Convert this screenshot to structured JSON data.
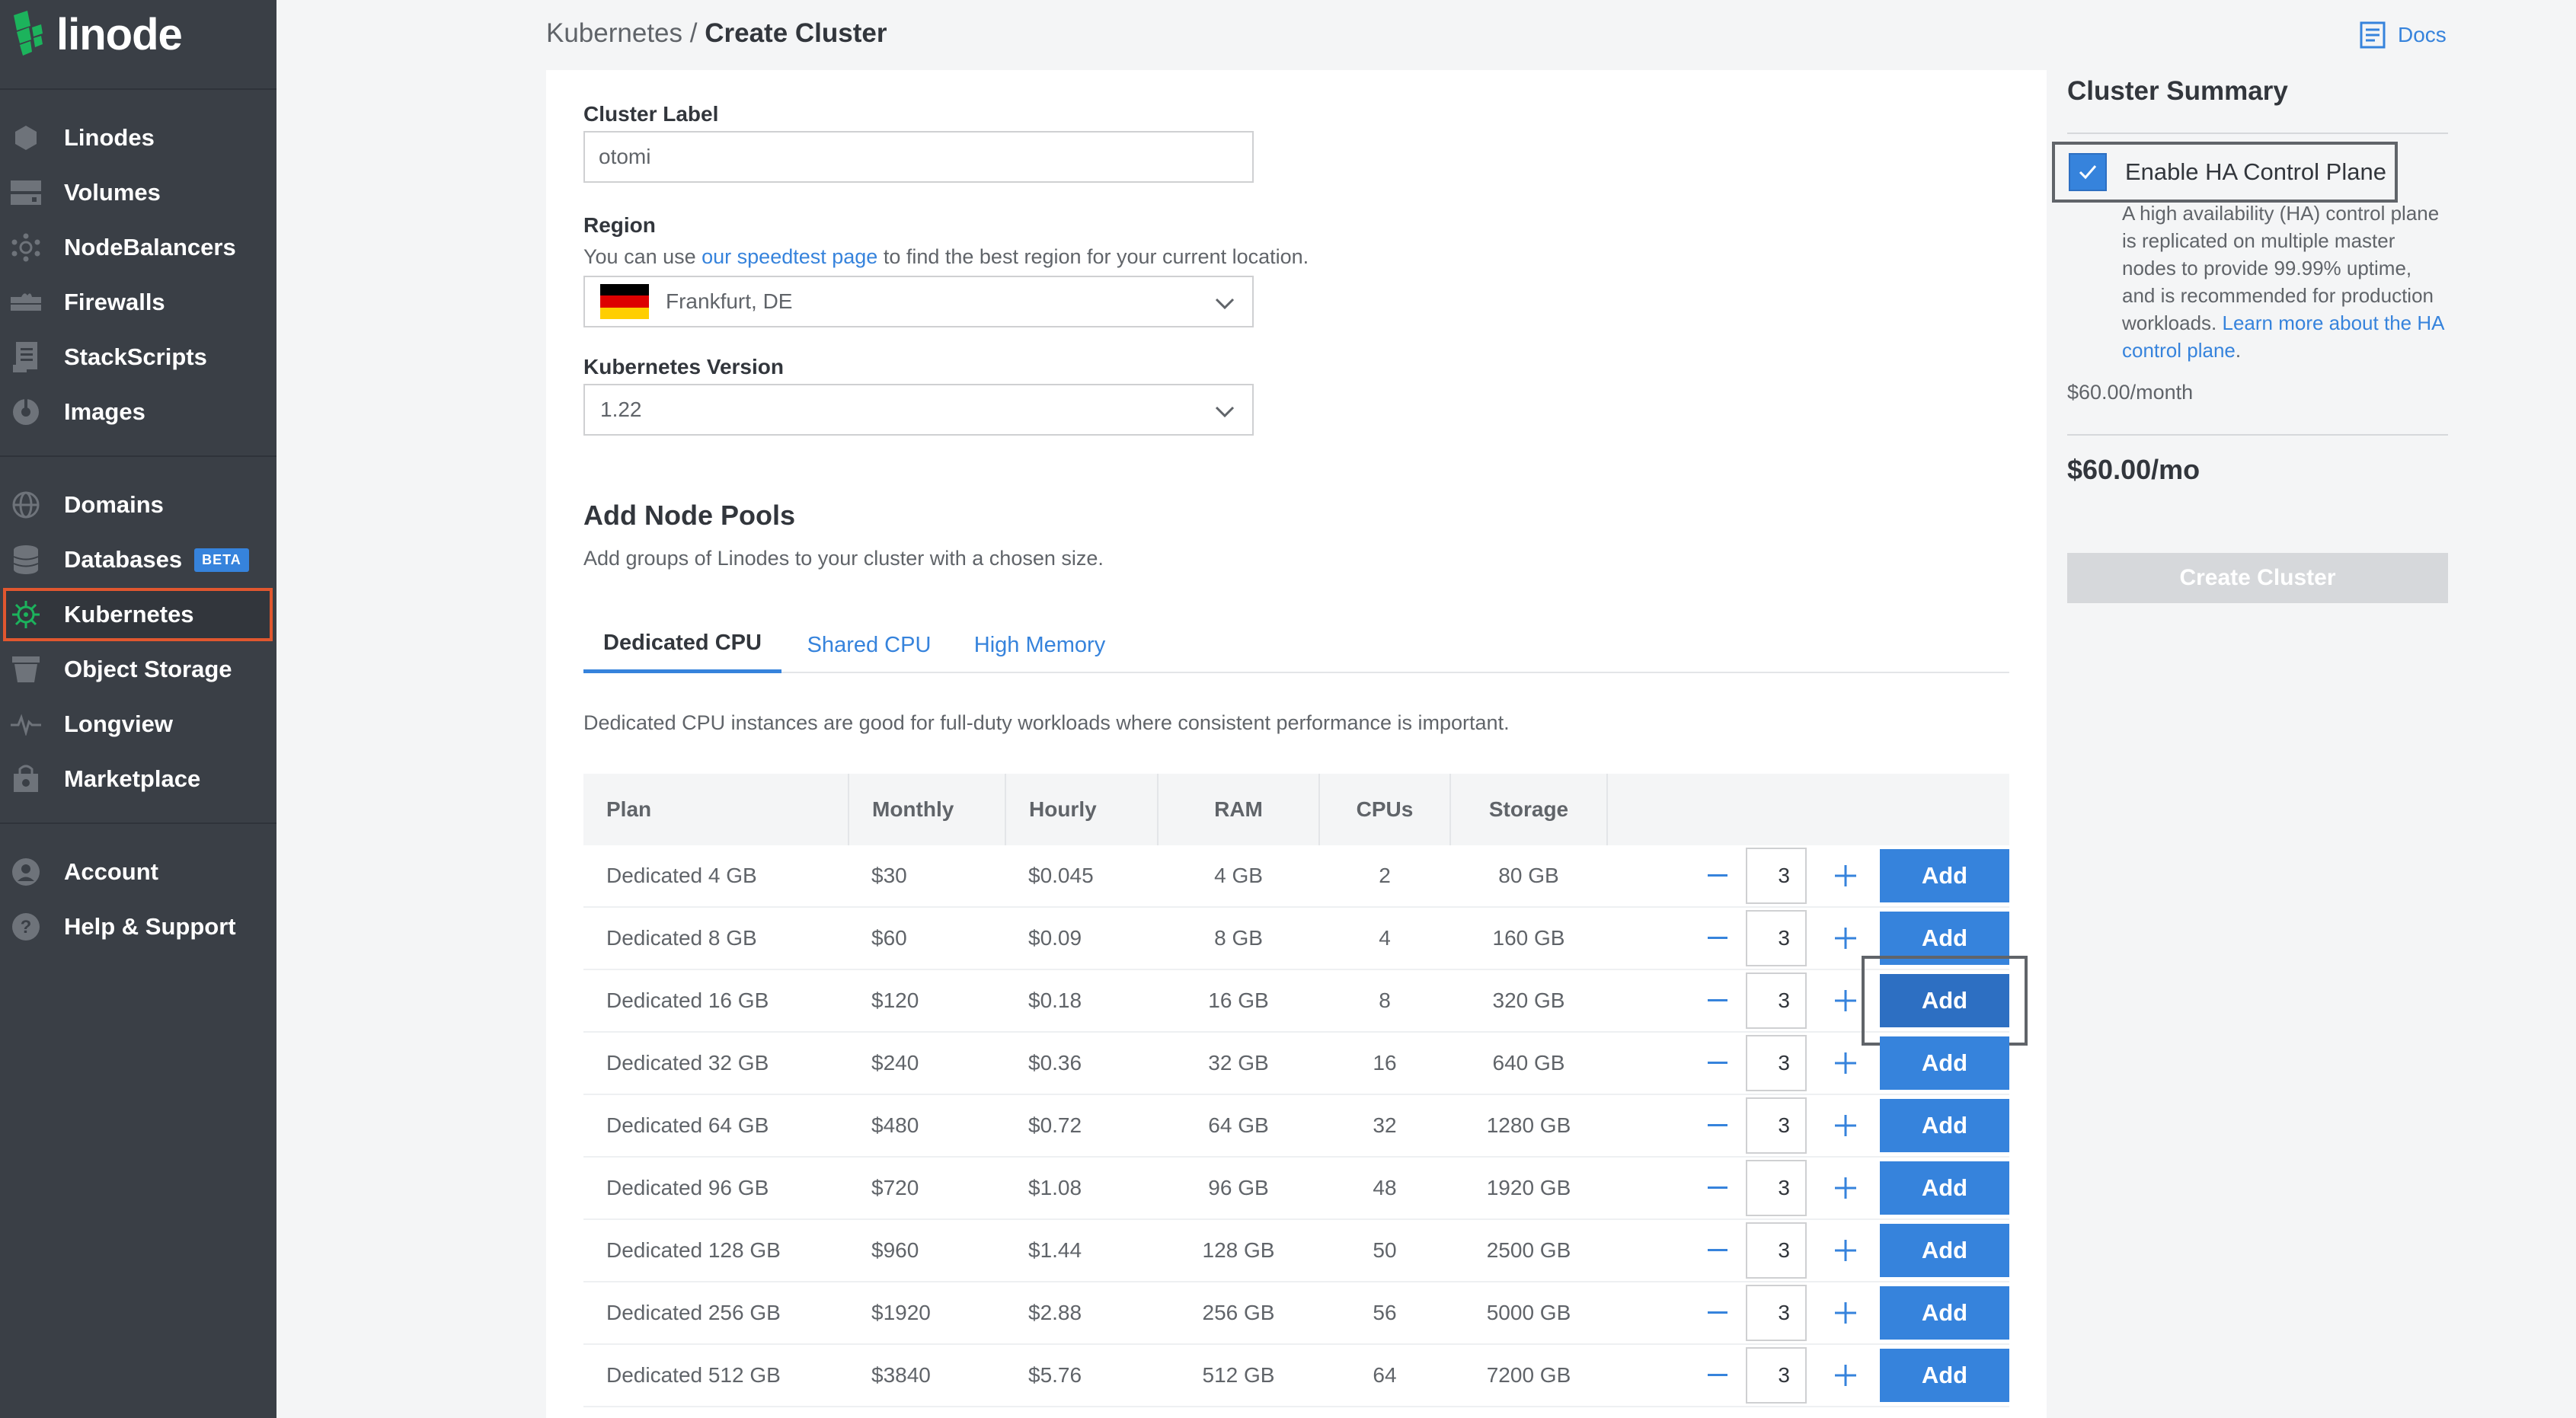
{
  "brand": {
    "name": "linode"
  },
  "nav": {
    "items": [
      {
        "label": "Linodes",
        "icon": "hexagon-icon"
      },
      {
        "label": "Volumes",
        "icon": "drives-icon"
      },
      {
        "label": "NodeBalancers",
        "icon": "network-icon"
      },
      {
        "label": "Firewalls",
        "icon": "firewall-icon"
      },
      {
        "label": "StackScripts",
        "icon": "script-icon"
      },
      {
        "label": "Images",
        "icon": "images-icon"
      },
      {
        "label": "Domains",
        "icon": "globe-icon"
      },
      {
        "label": "Databases",
        "icon": "database-icon",
        "badge": "BETA"
      },
      {
        "label": "Kubernetes",
        "icon": "kubernetes-icon",
        "active": true
      },
      {
        "label": "Object Storage",
        "icon": "bucket-icon"
      },
      {
        "label": "Longview",
        "icon": "pulse-icon"
      },
      {
        "label": "Marketplace",
        "icon": "marketplace-icon"
      },
      {
        "label": "Account",
        "icon": "account-icon"
      },
      {
        "label": "Help & Support",
        "icon": "help-icon"
      }
    ]
  },
  "header": {
    "breadcrumb_parent": "Kubernetes",
    "breadcrumb_sep": "/",
    "breadcrumb_current": "Create Cluster",
    "docs_label": "Docs"
  },
  "form": {
    "cluster_label": {
      "label": "Cluster Label",
      "value": "otomi"
    },
    "region": {
      "label": "Region",
      "helper_prefix": "You can use ",
      "helper_link": "our speedtest page",
      "helper_suffix": " to find the best region for your current location.",
      "value": "Frankfurt, DE"
    },
    "version": {
      "label": "Kubernetes Version",
      "value": "1.22"
    }
  },
  "node_pools": {
    "title": "Add Node Pools",
    "subtitle": "Add groups of Linodes to your cluster with a chosen size.",
    "tabs": [
      "Dedicated CPU",
      "Shared CPU",
      "High Memory"
    ],
    "description": "Dedicated CPU instances are good for full-duty workloads where consistent performance is important.",
    "columns": [
      "Plan",
      "Monthly",
      "Hourly",
      "RAM",
      "CPUs",
      "Storage"
    ],
    "add_label": "Add",
    "rows": [
      {
        "plan": "Dedicated 4 GB",
        "monthly": "$30",
        "hourly": "$0.045",
        "ram": "4 GB",
        "cpus": "2",
        "storage": "80 GB",
        "qty": "3"
      },
      {
        "plan": "Dedicated 8 GB",
        "monthly": "$60",
        "hourly": "$0.09",
        "ram": "8 GB",
        "cpus": "4",
        "storage": "160 GB",
        "qty": "3"
      },
      {
        "plan": "Dedicated 16 GB",
        "monthly": "$120",
        "hourly": "$0.18",
        "ram": "16 GB",
        "cpus": "8",
        "storage": "320 GB",
        "qty": "3",
        "highlight": true
      },
      {
        "plan": "Dedicated 32 GB",
        "monthly": "$240",
        "hourly": "$0.36",
        "ram": "32 GB",
        "cpus": "16",
        "storage": "640 GB",
        "qty": "3"
      },
      {
        "plan": "Dedicated 64 GB",
        "monthly": "$480",
        "hourly": "$0.72",
        "ram": "64 GB",
        "cpus": "32",
        "storage": "1280 GB",
        "qty": "3"
      },
      {
        "plan": "Dedicated 96 GB",
        "monthly": "$720",
        "hourly": "$1.08",
        "ram": "96 GB",
        "cpus": "48",
        "storage": "1920 GB",
        "qty": "3"
      },
      {
        "plan": "Dedicated 128 GB",
        "monthly": "$960",
        "hourly": "$1.44",
        "ram": "128 GB",
        "cpus": "50",
        "storage": "2500 GB",
        "qty": "3"
      },
      {
        "plan": "Dedicated 256 GB",
        "monthly": "$1920",
        "hourly": "$2.88",
        "ram": "256 GB",
        "cpus": "56",
        "storage": "5000 GB",
        "qty": "3"
      },
      {
        "plan": "Dedicated 512 GB",
        "monthly": "$3840",
        "hourly": "$5.76",
        "ram": "512 GB",
        "cpus": "64",
        "storage": "7200 GB",
        "qty": "3"
      }
    ]
  },
  "summary": {
    "title": "Cluster Summary",
    "ha_label": "Enable HA Control Plane",
    "ha_checked": true,
    "ha_desc": "A high availability (HA) control plane is replicated on multiple master nodes to provide 99.99% uptime, and is recommended for production workloads. ",
    "ha_link": "Learn more about the HA control plane",
    "ha_link_suffix": ".",
    "ha_price": "$60.00/month",
    "total": "$60.00/mo",
    "create_label": "Create Cluster"
  },
  "colors": {
    "sidebar_bg": "#3a3f46",
    "accent": "#3683dc",
    "active_outline": "#e1572f",
    "brand_green": "#1cb35c"
  }
}
